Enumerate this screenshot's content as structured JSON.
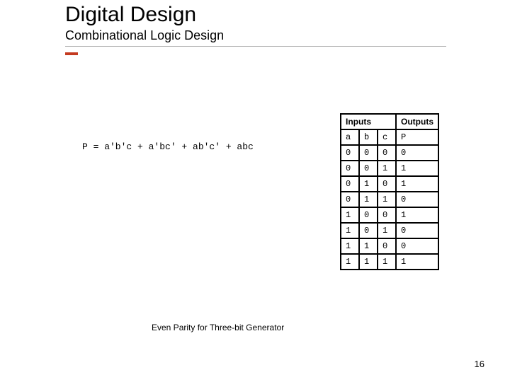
{
  "header": {
    "title": "Digital Design",
    "subtitle": "Combinational Logic Design"
  },
  "equation": "P = a'b'c + a'bc' + ab'c' + abc",
  "table": {
    "inputs_header": "Inputs",
    "outputs_header": "Outputs",
    "col_headers": {
      "a": "a",
      "b": "b",
      "c": "c",
      "p": "P"
    }
  },
  "chart_data": {
    "type": "table",
    "title": "Even Parity for Three-bit Generator",
    "columns": [
      "a",
      "b",
      "c",
      "P"
    ],
    "rows": [
      [
        0,
        0,
        0,
        0
      ],
      [
        0,
        0,
        1,
        1
      ],
      [
        0,
        1,
        0,
        1
      ],
      [
        0,
        1,
        1,
        0
      ],
      [
        1,
        0,
        0,
        1
      ],
      [
        1,
        0,
        1,
        0
      ],
      [
        1,
        1,
        0,
        0
      ],
      [
        1,
        1,
        1,
        1
      ]
    ]
  },
  "caption": "Even Parity for Three-bit Generator",
  "page_number": "16"
}
